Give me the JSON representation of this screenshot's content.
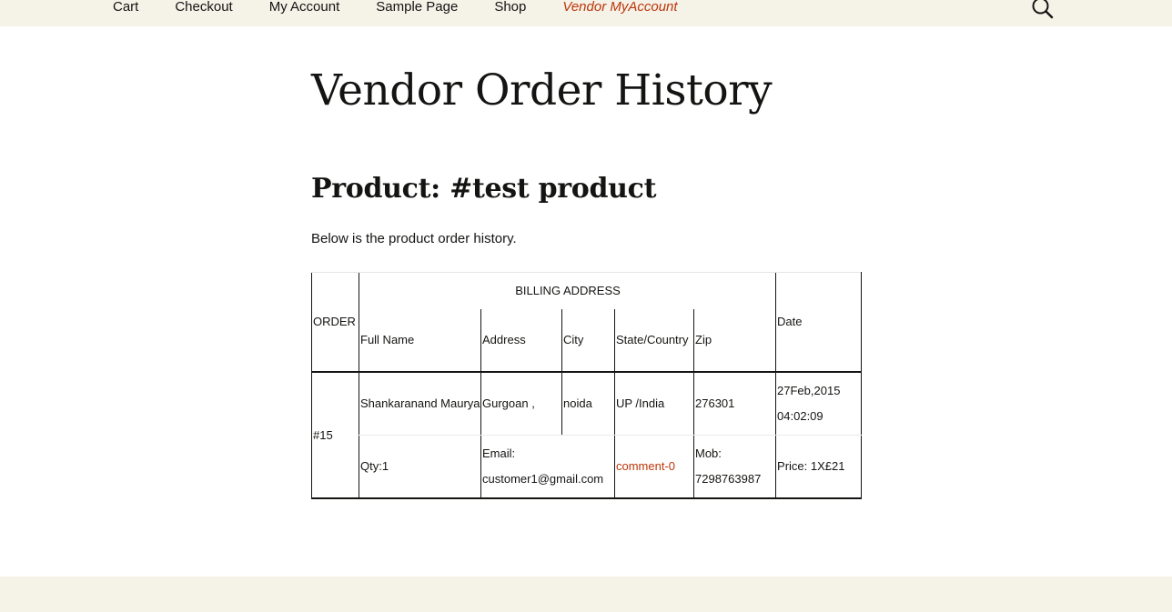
{
  "nav": {
    "items": [
      {
        "label": "Cart",
        "active": false
      },
      {
        "label": "Checkout",
        "active": false
      },
      {
        "label": "My Account",
        "active": false
      },
      {
        "label": "Sample Page",
        "active": false
      },
      {
        "label": "Shop",
        "active": false
      },
      {
        "label": "Vendor MyAccount",
        "active": true
      }
    ],
    "search_icon": "search-icon",
    "active_color": "#bc360a",
    "background": "#f5f2e8"
  },
  "page": {
    "title": "Vendor Order History",
    "product_heading": "Product: #test product",
    "intro": "Below is the product order history."
  },
  "table": {
    "header_order": "ORDER",
    "header_billing": "BILLING ADDRESS",
    "header_date": "Date",
    "columns": {
      "full_name": "Full Name",
      "address": "Address",
      "city": "City",
      "state_country": "State/Country",
      "zip": "Zip"
    },
    "rows": [
      {
        "order": "#15",
        "full_name": "Shankaranand Maurya",
        "address": "Gurgoan ,",
        "city": "noida",
        "state_country": "UP /India",
        "zip": "276301",
        "date": "27Feb,2015 04:02:09",
        "qty": "Qty:1",
        "email": "Email: customer1@gmail.com",
        "comment": "comment-0",
        "mobile": "Mob: 7298763987",
        "price": "Price: 1X£21"
      }
    ]
  }
}
